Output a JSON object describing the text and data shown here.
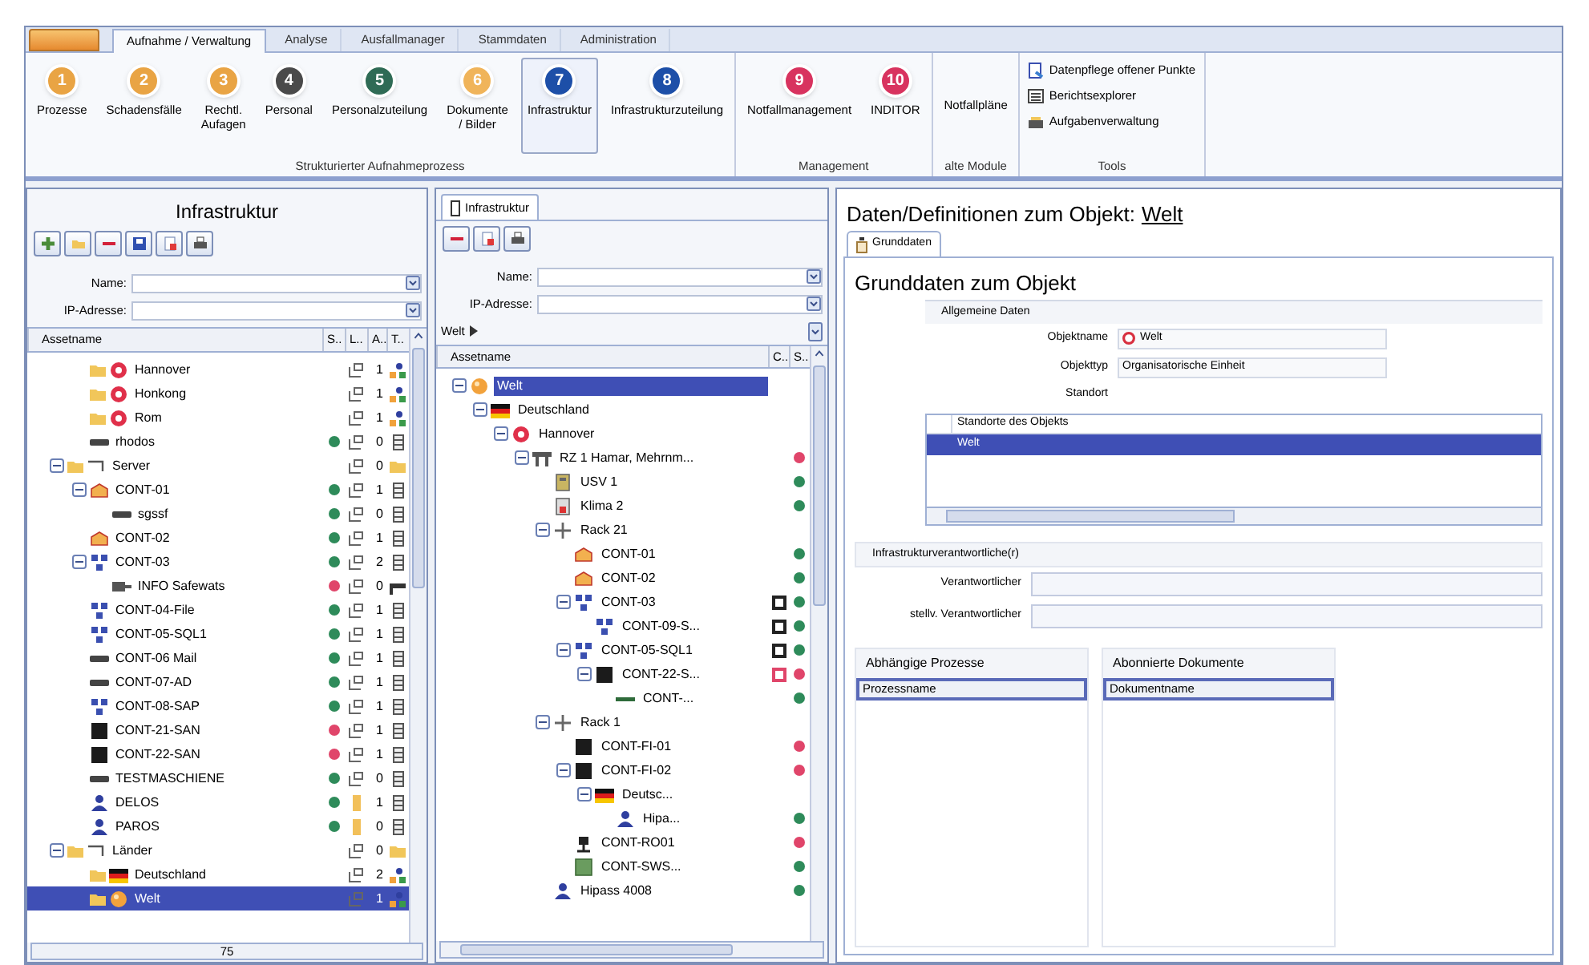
{
  "ribbon": {
    "tabs": [
      {
        "label": "Aufnahme / Verwaltung",
        "selected": true
      },
      {
        "label": "Analyse",
        "selected": false
      },
      {
        "label": "Ausfallmanager",
        "selected": false
      },
      {
        "label": "Stammdaten",
        "selected": false
      },
      {
        "label": "Administration",
        "selected": false
      }
    ],
    "groups": [
      {
        "label": "Strukturierter Aufnahmeprozess",
        "items": [
          {
            "kind": "large",
            "number": "1",
            "color": "#e9a444",
            "label": "Prozesse",
            "selected": false
          },
          {
            "kind": "large",
            "number": "2",
            "color": "#e9a444",
            "label": "Schadensfälle",
            "selected": false
          },
          {
            "kind": "large",
            "number": "3",
            "color": "#e9a444",
            "label": "Rechtl. Aufagen",
            "selected": false
          },
          {
            "kind": "large",
            "number": "4",
            "color": "#4a4a4a",
            "label": "Personal",
            "selected": false
          },
          {
            "kind": "large",
            "number": "5",
            "color": "#2f6b55",
            "label": "Personalzuteilung",
            "selected": false
          },
          {
            "kind": "large",
            "number": "6",
            "color": "#f0b45a",
            "label": "Dokumente / Bilder",
            "selected": false
          },
          {
            "kind": "large",
            "number": "7",
            "color": "#1d4fa8",
            "label": "Infrastruktur",
            "selected": true
          },
          {
            "kind": "large",
            "number": "8",
            "color": "#1d4fa8",
            "label": "Infrastrukturzuteilung",
            "selected": false
          }
        ]
      },
      {
        "label": "Management",
        "items": [
          {
            "kind": "large",
            "number": "9",
            "color": "#d8335f",
            "label": "Notfallmanagement",
            "selected": false
          },
          {
            "kind": "large",
            "number": "10",
            "color": "#d8335f",
            "label": "INDITOR",
            "selected": false
          }
        ]
      },
      {
        "label": "alte Module",
        "items": [
          {
            "kind": "text",
            "label": "Notfallpläne"
          }
        ]
      },
      {
        "label": "Tools",
        "items": [
          {
            "kind": "small",
            "label": "Datenpflege offener Punkte"
          },
          {
            "kind": "small",
            "label": "Berichtsexplorer"
          },
          {
            "kind": "small",
            "label": "Aufgabenverwaltung"
          }
        ]
      }
    ]
  },
  "left_panel": {
    "title": "Infrastruktur",
    "filters": [
      {
        "label": "Name:"
      },
      {
        "label": "IP-Adresse:"
      }
    ],
    "columns": [
      "Assetname",
      "S..",
      "L..",
      "A..",
      "T.."
    ],
    "tree": [
      {
        "children": [
          {
            "name": "Hannover",
            "kind": "pin",
            "count": "1",
            "selected": false
          },
          {
            "name": "Honkong",
            "kind": "pin",
            "count": "1",
            "selected": false
          },
          {
            "name": "Rom",
            "kind": "pin",
            "count": "1",
            "selected": false
          },
          {
            "name": "rhodos",
            "kind": "host",
            "color": "#2e8b5a",
            "count": "0",
            "selected": false
          }
        ]
      },
      {
        "name": "Server",
        "kind": "group",
        "count": "0",
        "expanded": true,
        "selected": false,
        "children": [
          {
            "name": "CONT-01",
            "kind": "container",
            "color": "#2e8b5a",
            "count": "1",
            "expanded": true,
            "selected": false,
            "children": [
              {
                "name": "sgssf",
                "kind": "host",
                "color": "#2e8b5a",
                "count": "0",
                "selected": false
              }
            ]
          },
          {
            "name": "CONT-02",
            "kind": "container",
            "color": "#2e8b5a",
            "count": "1",
            "selected": false
          },
          {
            "name": "CONT-03",
            "kind": "network",
            "color": "#2e8b5a",
            "count": "2",
            "expanded": true,
            "selected": false,
            "children": [
              {
                "name": "INFO Safewats",
                "kind": "device",
                "color": "#e0456a",
                "count": "0",
                "selected": false
              }
            ]
          },
          {
            "name": "CONT-04-File",
            "kind": "network",
            "color": "#2e8b5a",
            "count": "1",
            "selected": false
          },
          {
            "name": "CONT-05-SQL1",
            "kind": "network",
            "color": "#2e8b5a",
            "count": "1",
            "selected": false
          },
          {
            "name": "CONT-06 Mail",
            "kind": "host",
            "color": "#2e8b5a",
            "count": "1",
            "selected": false
          },
          {
            "name": "CONT-07-AD",
            "kind": "host",
            "color": "#2e8b5a",
            "count": "1",
            "selected": false
          },
          {
            "name": "CONT-08-SAP",
            "kind": "network",
            "color": "#2e8b5a",
            "count": "1",
            "selected": false
          },
          {
            "name": "CONT-21-SAN",
            "kind": "storage",
            "color": "#e0456a",
            "count": "1",
            "selected": false
          },
          {
            "name": "CONT-22-SAN",
            "kind": "storage",
            "color": "#e0456a",
            "count": "1",
            "selected": false
          },
          {
            "name": "TESTMASCHIENE",
            "kind": "host",
            "color": "#2e8b5a",
            "count": "0",
            "selected": false
          },
          {
            "name": "DELOS",
            "kind": "user",
            "color": "#2e8b5a",
            "count": "1",
            "selected": false
          },
          {
            "name": "PAROS",
            "kind": "user",
            "color": "#2e8b5a",
            "count": "0",
            "selected": false
          }
        ]
      },
      {
        "name": "Länder",
        "kind": "group",
        "count": "0",
        "expanded": true,
        "selected": false,
        "children": [
          {
            "name": "Deutschland",
            "kind": "flag",
            "count": "2",
            "selected": false
          },
          {
            "name": "Welt",
            "kind": "world",
            "count": "1",
            "selected": true
          }
        ]
      }
    ],
    "footer": "75"
  },
  "middle_panel": {
    "tab": {
      "label": "Infrastruktur",
      "selected": true
    },
    "filters": [
      {
        "label": "Name:"
      },
      {
        "label": "IP-Adresse:"
      }
    ],
    "breadcrumb": "Welt",
    "columns": [
      "Assetname",
      "C..",
      "S.."
    ],
    "tree": [
      {
        "name": "Welt",
        "kind": "world",
        "expanded": true,
        "selected": true,
        "children": [
          {
            "name": "Deutschland",
            "kind": "flag",
            "expanded": true,
            "selected": false,
            "children": [
              {
                "name": "Hannover",
                "kind": "pin",
                "expanded": true,
                "selected": false,
                "children": [
                  {
                    "name": "RZ 1 Hamar, Mehrnm...",
                    "kind": "site",
                    "color": "#e0456a",
                    "expanded": true,
                    "selected": false,
                    "children": [
                      {
                        "name": "USV 1",
                        "kind": "ups",
                        "color": "#2e8b5a",
                        "selected": false
                      },
                      {
                        "name": "Klima 2",
                        "kind": "cooling",
                        "color": "#2e8b5a",
                        "selected": false
                      },
                      {
                        "name": "Rack 21",
                        "kind": "rack",
                        "expanded": true,
                        "selected": false,
                        "children": [
                          {
                            "name": "CONT-01",
                            "kind": "container",
                            "color": "#2e8b5a",
                            "selected": false
                          },
                          {
                            "name": "CONT-02",
                            "kind": "container",
                            "color": "#2e8b5a",
                            "selected": false
                          },
                          {
                            "name": "CONT-03",
                            "kind": "network",
                            "warning": false,
                            "color": "#2e8b5a",
                            "expanded": true,
                            "selected": false,
                            "children": [
                              {
                                "name": "CONT-09-S...",
                                "kind": "network",
                                "warning": false,
                                "color": "#2e8b5a",
                                "selected": false
                              }
                            ]
                          },
                          {
                            "name": "CONT-05-SQL1",
                            "kind": "network",
                            "warning": false,
                            "color": "#2e8b5a",
                            "expanded": true,
                            "selected": false,
                            "children": [
                              {
                                "name": "CONT-22-S...",
                                "kind": "storage",
                                "warning": true,
                                "color": "#e0456a",
                                "expanded": true,
                                "selected": false,
                                "children": [
                                  {
                                    "name": "CONT-...",
                                    "kind": "link",
                                    "color": "#2e8b5a",
                                    "selected": false
                                  }
                                ]
                              }
                            ]
                          }
                        ]
                      },
                      {
                        "name": "Rack 1",
                        "kind": "rack",
                        "expanded": true,
                        "selected": false,
                        "children": [
                          {
                            "name": "CONT-FI-01",
                            "kind": "storage",
                            "color": "#e0456a",
                            "selected": false
                          },
                          {
                            "name": "CONT-FI-02",
                            "kind": "storage",
                            "color": "#e0456a",
                            "expanded": true,
                            "selected": false,
                            "children": [
                              {
                                "name": "Deutsc...",
                                "kind": "flag",
                                "expanded": true,
                                "selected": false,
                                "children": [
                                  {
                                    "name": "Hipa...",
                                    "kind": "user",
                                    "color": "#2e8b5a",
                                    "selected": false
                                  }
                                ]
                              }
                            ]
                          },
                          {
                            "name": "CONT-RO01",
                            "kind": "router",
                            "color": "#e0456a",
                            "selected": false
                          },
                          {
                            "name": "CONT-SWS...",
                            "kind": "switch",
                            "color": "#2e8b5a",
                            "selected": false
                          }
                        ]
                      },
                      {
                        "name": "Hipass 4008",
                        "kind": "user",
                        "color": "#2e8b5a",
                        "selected": false
                      }
                    ]
                  }
                ]
              }
            ]
          }
        ]
      }
    ]
  },
  "right_panel": {
    "title": "Daten/Definitionen zum Objekt:",
    "object_link": "Welt",
    "tab": {
      "label": "Grunddaten",
      "selected": true
    },
    "heading": "Grunddaten zum Objekt",
    "general": {
      "title": "Allgemeine Daten",
      "fields": [
        {
          "label": "Objektname",
          "value": "Welt",
          "kind": "status"
        },
        {
          "label": "Objekttyp",
          "value": "Organisatorische Einheit",
          "kind": "plain"
        }
      ],
      "location_label": "Standort",
      "locations": {
        "column": "Standorte des Objekts",
        "rows": [
          {
            "label": "Welt",
            "selected": true
          }
        ]
      }
    },
    "responsible": {
      "title": "Infrastrukturverantwortliche(r)",
      "fields": [
        {
          "label": "Verantwortlicher"
        },
        {
          "label": "stellv. Verantwortlicher"
        }
      ]
    },
    "processes": {
      "title": "Abhängige Prozesse",
      "column": "Prozessname"
    },
    "documents": {
      "title": "Abonnierte Dokumente",
      "column": "Dokumentname"
    }
  }
}
